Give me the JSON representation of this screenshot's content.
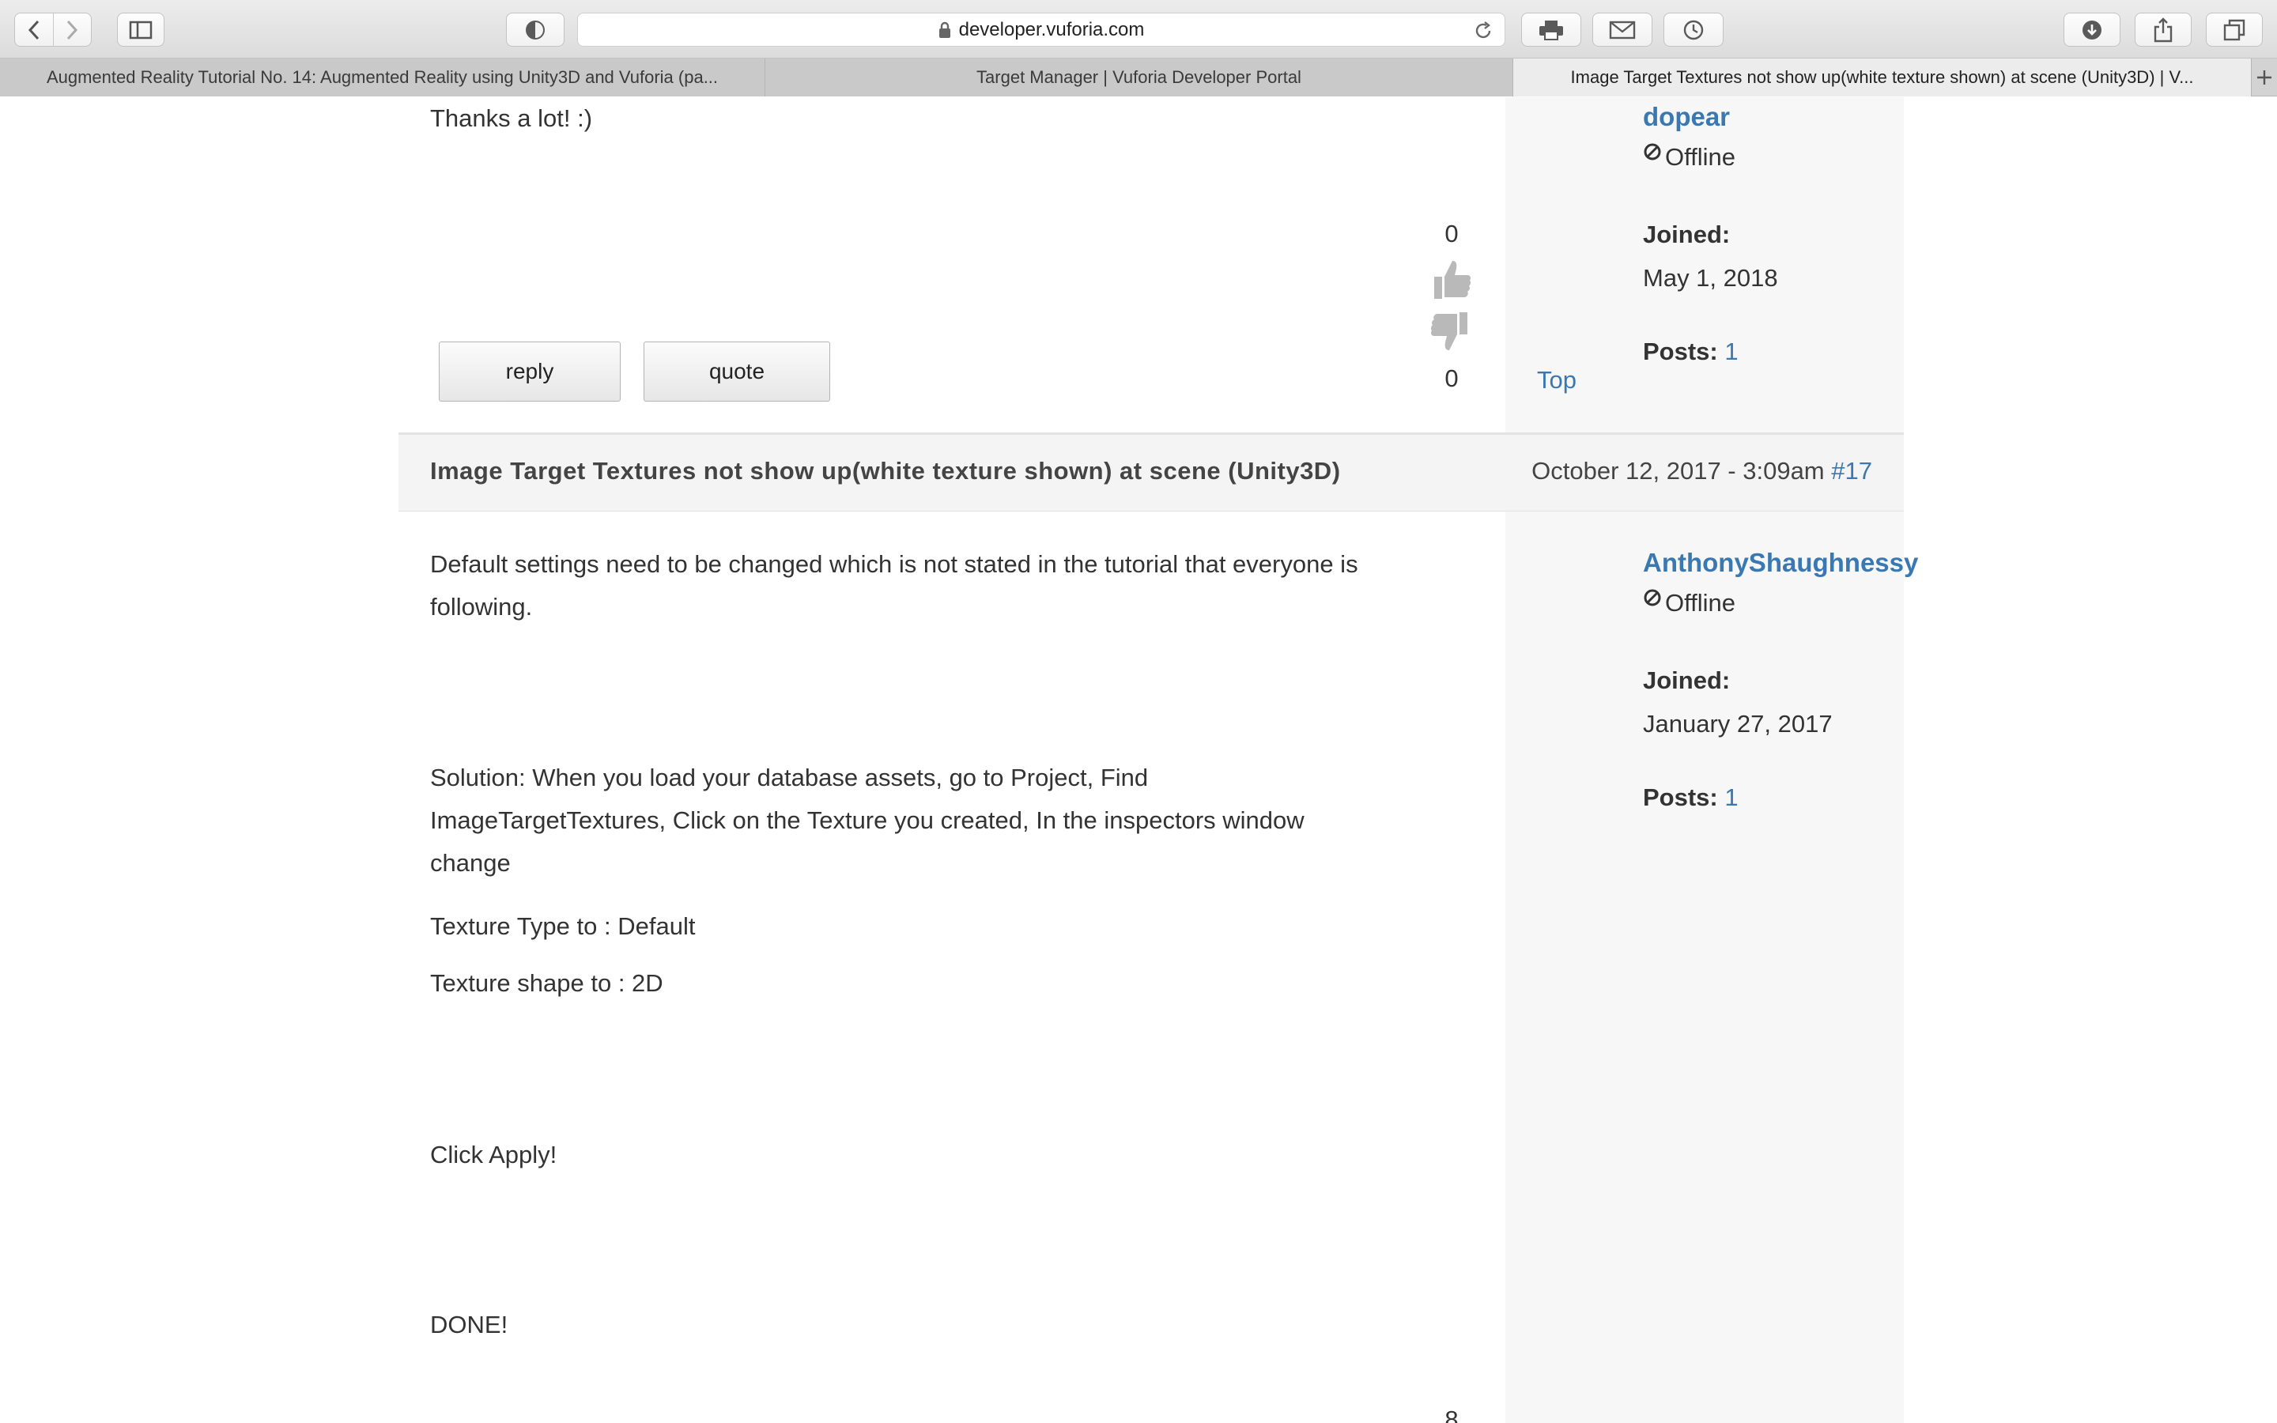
{
  "browser": {
    "url": "developer.vuforia.com",
    "tabs": [
      "Augmented Reality Tutorial No. 14: Augmented Reality using Unity3D and Vuforia (pa...",
      "Target Manager | Vuforia Developer Portal",
      "Image Target Textures not show up(white texture shown) at scene (Unity3D) | V..."
    ]
  },
  "previous_post": {
    "body_tail": "Thanks a lot! :)",
    "author": {
      "name": "dopear",
      "status": "Offline",
      "joined_label": "Joined:",
      "joined": "May 1, 2018",
      "posts_label": "Posts:",
      "posts": "1"
    },
    "votes": {
      "up": "0",
      "down": "0"
    },
    "reply_label": "reply",
    "quote_label": "quote",
    "top_label": "Top"
  },
  "post": {
    "title": "Image Target Textures not show up(white texture shown) at scene (Unity3D)",
    "date": "October 12, 2017 - 3:09am",
    "number": "#17",
    "author": {
      "name": "AnthonyShaughnessy",
      "status": "Offline",
      "joined_label": "Joined:",
      "joined": "January 27, 2017",
      "posts_label": "Posts:",
      "posts": "1"
    },
    "paragraphs": {
      "p1_line1": "Default settings need to be changed which is not stated in the tutorial that everyone is",
      "p1_line2": "following.",
      "p2_line1": "Solution: When you load your database assets, go to Project, Find",
      "p2_line2": "ImageTargetTextures, Click on the Texture you created, In the inspectors window",
      "p2_line3": "change",
      "p3": "Texture Type to : Default",
      "p4": "Texture shape to : 2D",
      "p5": "Click Apply!",
      "p6": "DONE!"
    },
    "vote_partial": "8"
  }
}
